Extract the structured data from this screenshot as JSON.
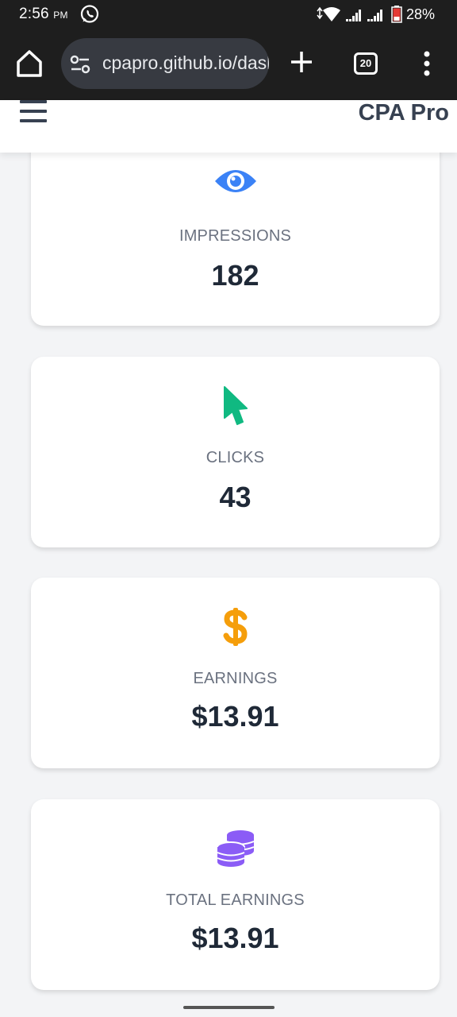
{
  "status_bar": {
    "time": "2:56",
    "time_suffix": "PM",
    "battery": "28%",
    "icons": [
      "whatsapp-icon",
      "wifi-icon",
      "signal-icon",
      "battery-icon"
    ]
  },
  "browser": {
    "url": "cpapro.github.io/dashboard",
    "tab_count": "20",
    "icons": [
      "home-icon",
      "tune-icon",
      "plus-icon",
      "more-vert-icon"
    ]
  },
  "header": {
    "brand": "CPA Pro",
    "menu_icon": "hamburger-icon"
  },
  "cards": [
    {
      "label": "IMPRESSIONS",
      "value": "182",
      "icon": "eye-icon",
      "color": "#3b82f6"
    },
    {
      "label": "CLICKS",
      "value": "43",
      "icon": "cursor-icon",
      "color": "#10b981"
    },
    {
      "label": "EARNINGS",
      "value": "$13.91",
      "icon": "dollar-icon",
      "color": "#f59e0b"
    },
    {
      "label": "TOTAL EARNINGS",
      "value": "$13.91",
      "icon": "coins-icon",
      "color": "#8b5cf6"
    }
  ]
}
